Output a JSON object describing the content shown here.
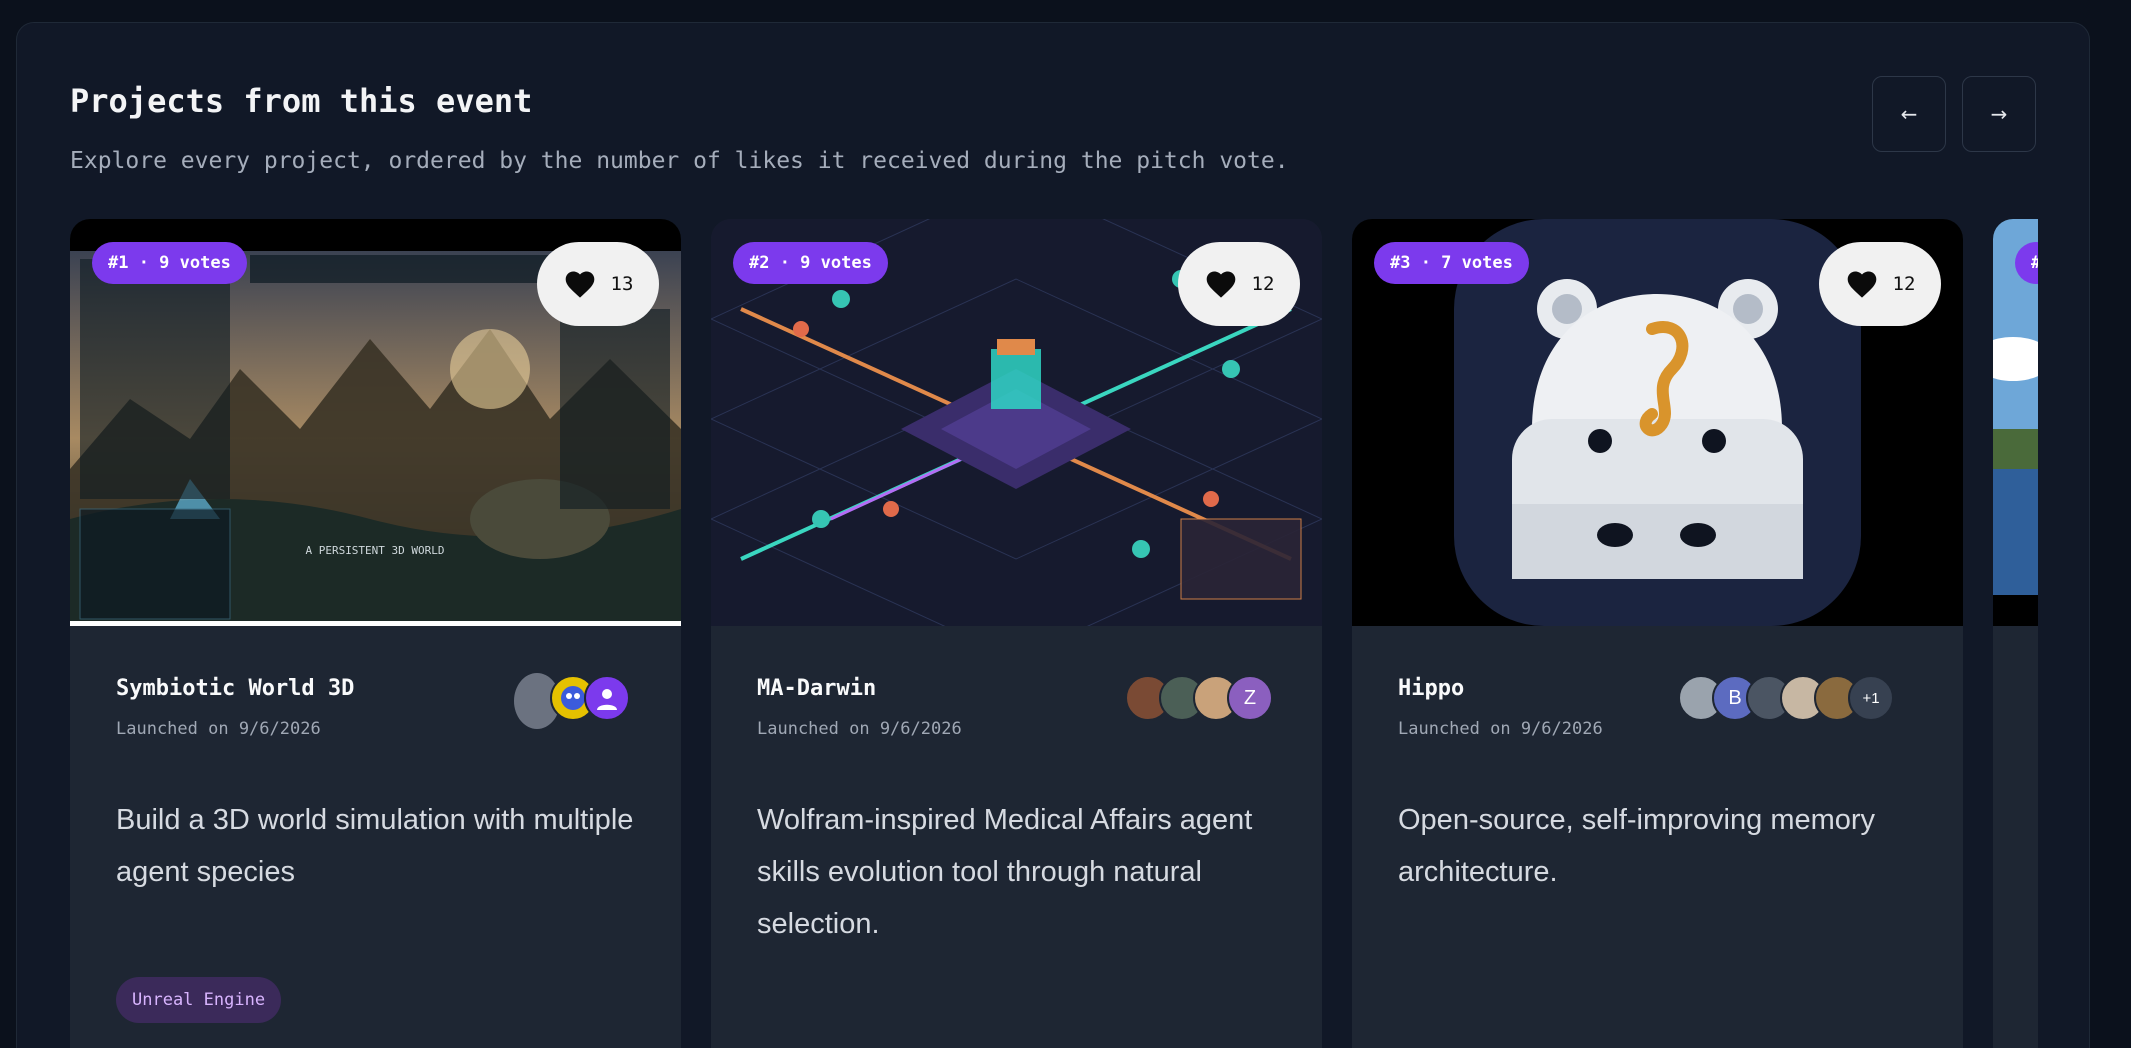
{
  "section": {
    "title": "Projects from this event",
    "subtitle": "Explore every project, ordered by the number of likes it received during the pitch vote."
  },
  "nav": {
    "prev": "←",
    "next": "→"
  },
  "projects": [
    {
      "rank": "#1 · 9 votes",
      "likes": "13",
      "name": "Symbiotic World 3D",
      "date": "Launched on 9/6/2026",
      "description": "Build a 3D world simulation with multiple agent species",
      "tag": "Unreal Engine",
      "image_text": "A PERSISTENT 3D WORLD"
    },
    {
      "rank": "#2 · 9 votes",
      "likes": "12",
      "name": "MA-Darwin",
      "date": "Launched on 9/6/2026",
      "description": "Wolfram-inspired Medical Affairs agent skills evolution tool through natural selection.",
      "avatar_initial": "Z"
    },
    {
      "rank": "#3 · 7 votes",
      "likes": "12",
      "name": "Hippo",
      "date": "Launched on 9/6/2026",
      "description": "Open-source, self-improving memory architecture.",
      "avatar_initial": "B",
      "avatar_more": "+1"
    },
    {
      "rank": "#"
    }
  ],
  "colors": {
    "accent": "#7c3aed",
    "card_bg": "#1e2633",
    "panel_bg": "#111827"
  },
  "icons": {
    "like": "heart-icon"
  }
}
